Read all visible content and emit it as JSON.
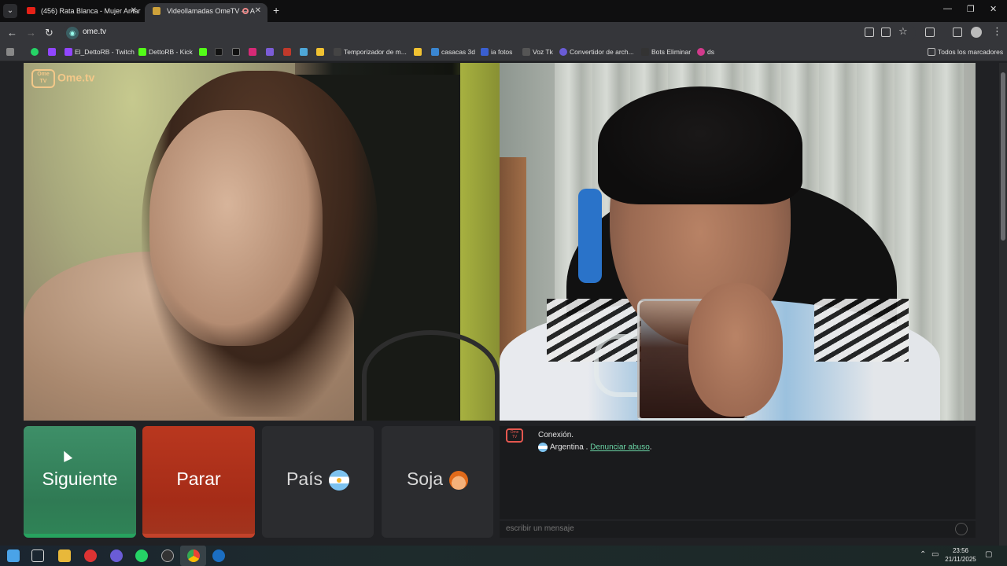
{
  "browser": {
    "tabs": [
      {
        "title": "(456) Rata Blanca - Mujer Amar",
        "close": "✕"
      },
      {
        "title": "Videollamadas OmeTV — A",
        "close": "✕"
      }
    ],
    "new_tab": "+",
    "window_controls": {
      "minimize": "—",
      "restore": "❐",
      "close": "✕"
    },
    "url": "ome.tv",
    "bookmarks": [
      {
        "label": "El_DettoRB - Twitch",
        "color": "#9146ff"
      },
      {
        "label": "DettoRB - Kick",
        "color": "#53fc18"
      },
      {
        "label": "Temporizador de m...",
        "color": "#444444"
      },
      {
        "label": "casacas 3d",
        "color": "#3a86d1"
      },
      {
        "label": "ia fotos",
        "color": "#3a5fd1"
      },
      {
        "label": "Voz Tk",
        "color": "#555555"
      },
      {
        "label": "Convertidor de arch...",
        "color": "#6a5cd6"
      },
      {
        "label": "Bots Eliminar",
        "color": "#333333"
      },
      {
        "label": "ds",
        "color": "#d13a8b"
      }
    ],
    "all_bookmarks": "Todos los marcadores"
  },
  "page": {
    "logo": "Ome.tv",
    "logo_small": "Ome TV",
    "buttons": {
      "next": "Siguiente",
      "stop": "Parar",
      "country": "País",
      "soja": "Soja"
    },
    "chat": {
      "status": "Conexión.",
      "country": "Argentina .",
      "report": "Denunciar abuso",
      "report_suffix": ".",
      "input_placeholder": "escribir un mensaje"
    }
  },
  "taskbar": {
    "time": "23:56",
    "date": "21/11/2025"
  },
  "colors": {
    "next_button": "#2f7a54",
    "stop_button": "#a52c17",
    "report_link": "#6ad3a4"
  }
}
